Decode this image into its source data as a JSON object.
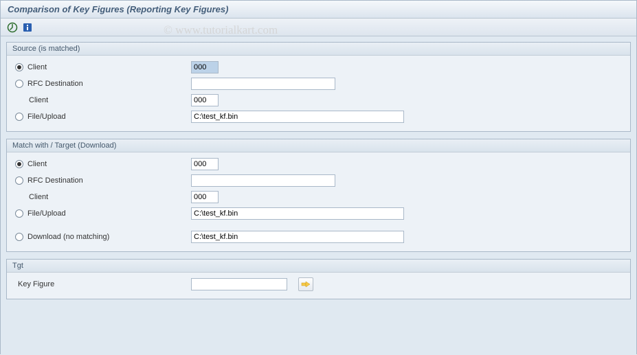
{
  "window": {
    "title": "Comparison of Key Figures (Reporting Key Figures)"
  },
  "watermark": "© www.tutorialkart.com",
  "toolbar": {
    "execute_icon": "execute",
    "info_icon": "info"
  },
  "source_group": {
    "title": "Source (is matched)",
    "client_label": "Client",
    "client_value": "000",
    "rfc_label": "RFC Destination",
    "rfc_value": "",
    "rfc_client_label": "Client",
    "rfc_client_value": "000",
    "file_label": "File/Upload",
    "file_value": "C:\\test_kf.bin"
  },
  "target_group": {
    "title": "Match with / Target (Download)",
    "client_label": "Client",
    "client_value": "000",
    "rfc_label": "RFC Destination",
    "rfc_value": "",
    "rfc_client_label": "Client",
    "rfc_client_value": "000",
    "file_label": "File/Upload",
    "file_value": "C:\\test_kf.bin",
    "download_label": "Download (no matching)",
    "download_value": "C:\\test_kf.bin"
  },
  "tgt_group": {
    "title": "Tgt",
    "keyfigure_label": "Key Figure",
    "keyfigure_value": ""
  }
}
